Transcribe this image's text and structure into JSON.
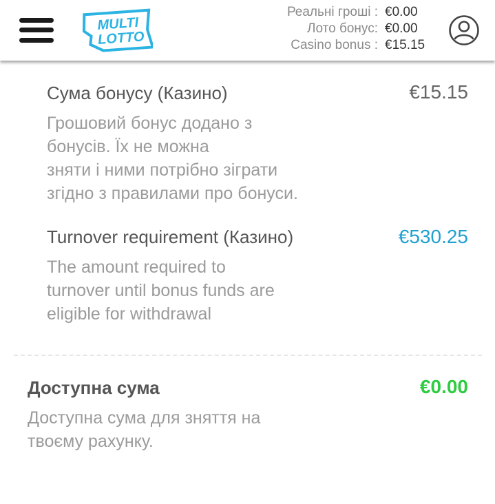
{
  "header": {
    "balances": [
      {
        "label": "Реальні гроші :",
        "value": "€0.00"
      },
      {
        "label": "Лото бонус:",
        "value": "€0.00"
      },
      {
        "label": "Casino bonus :",
        "value": "€15.15"
      }
    ],
    "logo": {
      "line1": "MULTI",
      "line2": "LOTTO",
      "color": "#2bb3e3"
    }
  },
  "items": [
    {
      "title": "Сума бонусу (Казино)",
      "value": "€15.15",
      "value_color": "#666666",
      "description": [
        "Грошовий бонус додано з",
        "бонусів. Їх не можна",
        "зняти і ними потрібно зіграти",
        "згідно з правилами про бонуси."
      ]
    },
    {
      "title": "Turnover requirement (Казино)",
      "value": "€530.25",
      "value_color": "#1ea0d0",
      "description": [
        "The amount required to",
        "turnover until bonus funds are",
        "eligible for withdrawal"
      ]
    }
  ],
  "available": {
    "title": "Доступна сума",
    "value": "€0.00",
    "value_color": "#2ecc40",
    "description": [
      "Доступна сума для зняття на",
      "твоєму рахунку."
    ]
  }
}
